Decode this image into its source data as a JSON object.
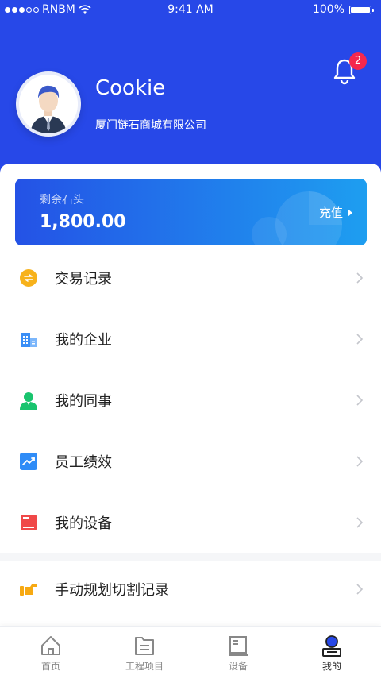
{
  "status_bar": {
    "carrier": "RNBM",
    "time": "9:41 AM",
    "battery": "100%"
  },
  "header": {
    "user_name": "Cookie",
    "company": "厦门链石商城有限公司",
    "notification_count": "2"
  },
  "balance": {
    "label": "剩余石头",
    "value": "1,800.00",
    "recharge_label": "充值"
  },
  "menu": [
    {
      "label": "交易记录",
      "icon": "transactions-icon",
      "color": "#f7b21b"
    },
    {
      "label": "我的企业",
      "icon": "enterprise-icon",
      "color": "#3a8ef6"
    },
    {
      "label": "我的同事",
      "icon": "colleague-icon",
      "color": "#19c46e"
    },
    {
      "label": "员工绩效",
      "icon": "performance-icon",
      "color": "#2f8cf7"
    },
    {
      "label": "我的设备",
      "icon": "device-icon",
      "color": "#f04848"
    }
  ],
  "menu_extra": {
    "label": "手动规划切割记录",
    "icon": "hand-point-icon",
    "color": "#f7a912"
  },
  "tabs": [
    {
      "label": "首页",
      "icon": "home-icon"
    },
    {
      "label": "工程项目",
      "icon": "projects-icon"
    },
    {
      "label": "设备",
      "icon": "equipment-icon"
    },
    {
      "label": "我的",
      "icon": "profile-icon",
      "active": true
    }
  ],
  "colors": {
    "primary": "#2748e8",
    "badge": "#f5284e",
    "card_start": "#2452e6",
    "card_end": "#1e9ef0"
  }
}
